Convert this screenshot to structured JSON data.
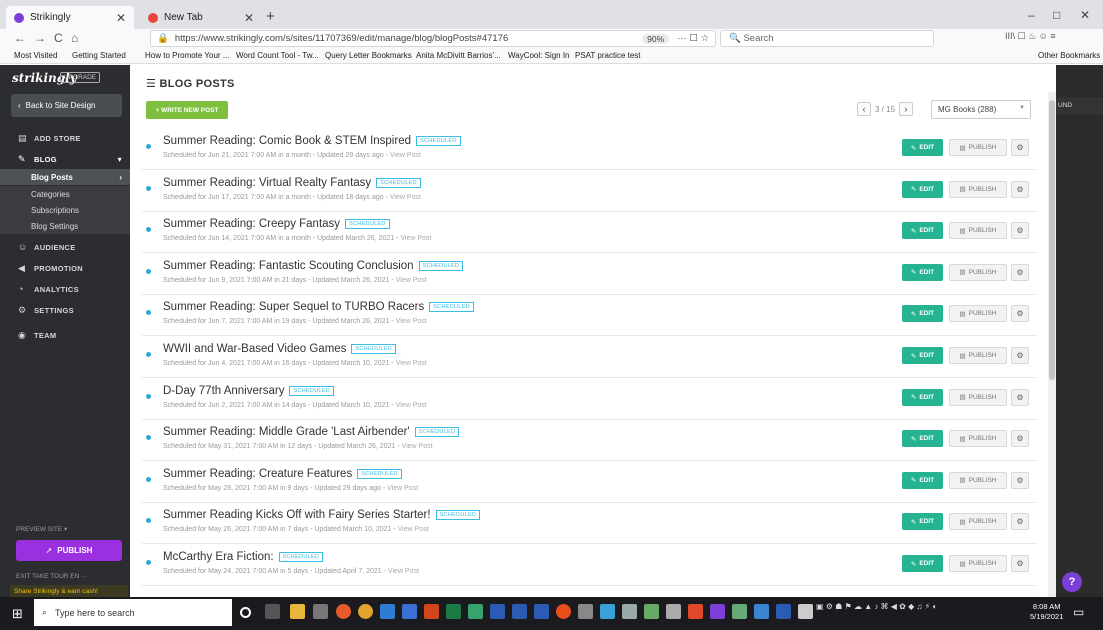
{
  "browser": {
    "tabs": [
      {
        "label": "Strikingly",
        "active": true,
        "favicon_color": "#7b3fd8"
      },
      {
        "label": "New Tab",
        "active": false,
        "favicon_color": "#e8453c"
      }
    ],
    "new_tab_symbol": "+",
    "window_controls": [
      "–",
      "□",
      "✕"
    ],
    "nav_icons": [
      "←",
      "→",
      "C",
      "⌂"
    ],
    "url": "https://www.strikingly.com/s/sites/11707369/edit/manage/blog/blogPosts#47176",
    "zoom": "90%",
    "url_actions": "··· ☐ ☆",
    "search_placeholder": "Search",
    "toolbar_right": "III\\ ☐ ♨ ☺ ≡",
    "bookmarks": [
      "Most Visited",
      "Getting Started",
      "How to Promote Your ...",
      "Word Count Tool - Tw...",
      "Query Letter Bookmarks",
      "Anita McDivitt Barrios'...",
      "WayCool: Sign In",
      "PSAT practice test"
    ],
    "other_bookmarks": "Other Bookmarks"
  },
  "sidebar": {
    "logo": "strikingly",
    "upgrade": "UPGRADE",
    "back_label": "Back to Site Design",
    "items": {
      "add_store": "ADD STORE",
      "blog": "BLOG",
      "audience": "AUDIENCE",
      "promotion": "PROMOTION",
      "analytics": "ANALYTICS",
      "settings": "SETTINGS",
      "team": "TEAM"
    },
    "blog_sub": [
      "Blog Posts",
      "Categories",
      "Subscriptions",
      "Blog Settings"
    ],
    "preview_site": "PREVIEW SITE ▾",
    "publish": "PUBLISH",
    "footer": "EXIT   TAKE TOUR   EN   ···",
    "share": "Share Strikingly & earn cash!"
  },
  "main": {
    "title": "BLOG POSTS",
    "write_button": "+ WRITE NEW POST",
    "pager": "3 / 15",
    "book_filter": "MG Books (288)",
    "edit_label": "EDIT",
    "publish_label": "PUBLISH",
    "badge": "SCHEDULED",
    "view_post": "View Post",
    "posts": [
      {
        "title": "Summer Reading: Comic Book & STEM Inspired",
        "meta": "Scheduled for Jun 21, 2021 7:00 AM in a month - Updated 29 days ago - "
      },
      {
        "title": "Summer Reading: Virtual Realty Fantasy",
        "meta": "Scheduled for Jun 17, 2021 7:00 AM in a month - Updated 18 days ago - "
      },
      {
        "title": "Summer Reading: Creepy Fantasy",
        "meta": "Scheduled for Jun 14, 2021 7:00 AM in a month - Updated March 26, 2021 - "
      },
      {
        "title": "Summer Reading: Fantastic Scouting Conclusion",
        "meta": "Scheduled for Jun 9, 2021 7:00 AM in 21 days - Updated March 26, 2021 - "
      },
      {
        "title": "Summer Reading: Super Sequel to TURBO Racers",
        "meta": "Scheduled for Jun 7, 2021 7:00 AM in 19 days - Updated March 26, 2021 - "
      },
      {
        "title": "WWII and War-Based Video Games",
        "meta": "Scheduled for Jun 4, 2021 7:00 AM in 16 days - Updated March 10, 2021 - "
      },
      {
        "title": "D-Day 77th Anniversary",
        "meta": "Scheduled for Jun 2, 2021 7:00 AM in 14 days - Updated March 10, 2021 - "
      },
      {
        "title": "Summer Reading: Middle Grade 'Last Airbender'",
        "meta": "Scheduled for May 31, 2021 7:00 AM in 12 days - Updated March 26, 2021 - "
      },
      {
        "title": "Summer Reading: Creature Features",
        "meta": "Scheduled for May 28, 2021 7:00 AM in 9 days - Updated 29 days ago - "
      },
      {
        "title": "Summer Reading Kicks Off with Fairy Series Starter!",
        "meta": "Scheduled for May 26, 2021 7:00 AM in 7 days - Updated March 10, 2021 - "
      },
      {
        "title": "McCarthy Era Fiction:",
        "meta": "Scheduled for May 24, 2021 7:00 AM in 5 days - Updated April 7, 2021 - "
      }
    ]
  },
  "right_panel": {
    "found_label": "UND",
    "help": "?"
  },
  "taskbar": {
    "search_placeholder": "Type here to search",
    "time": "8:08 AM",
    "date": "5/19/2021"
  }
}
